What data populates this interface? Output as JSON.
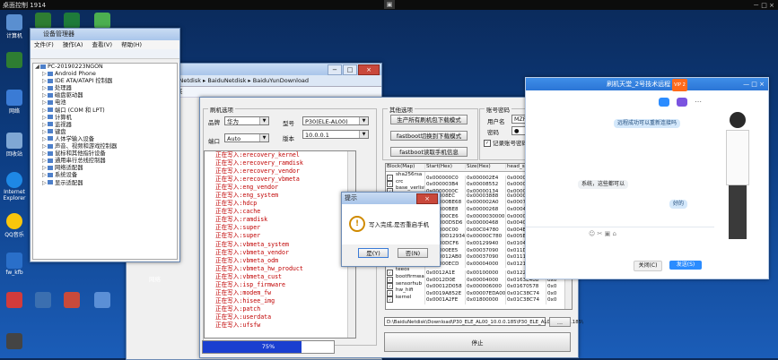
{
  "remote": {
    "title": "桌面控制 1914",
    "controls": "－ □ ×",
    "center_btn": "▣"
  },
  "desktop_icons": [
    {
      "label": "计算机",
      "color": "#5a8fd0"
    },
    {
      "label": "",
      "color": "#2e7d32"
    },
    {
      "label": "网络",
      "color": "#3a7bd5"
    },
    {
      "label": "回收站",
      "color": "#7fa7d4"
    },
    {
      "label": "Internet Explorer",
      "color": "#1e88e5"
    },
    {
      "label": "QQ音乐",
      "color": "#f9c60c"
    },
    {
      "label": "fw_kfb",
      "color": "#2a6fc9"
    },
    {
      "label": "",
      "color": "#d23b3b"
    }
  ],
  "devmgr": {
    "title": "设备管理器",
    "menu": [
      "文件(F)",
      "操作(A)",
      "查看(V)",
      "帮助(H)"
    ],
    "tree": [
      {
        "label": "PC-20190223NGON",
        "level": 0,
        "tri": "◢"
      },
      {
        "label": "Android Phone",
        "level": 1,
        "tri": "▷"
      },
      {
        "label": "IDE ATA/ATAPI 控制器",
        "level": 1,
        "tri": "▷"
      },
      {
        "label": "处理器",
        "level": 1,
        "tri": "▷"
      },
      {
        "label": "磁盘驱动器",
        "level": 1,
        "tri": "▷"
      },
      {
        "label": "电池",
        "level": 1,
        "tri": "▷"
      },
      {
        "label": "端口 (COM 和 LPT)",
        "level": 1,
        "tri": "▷"
      },
      {
        "label": "计算机",
        "level": 1,
        "tri": "▷"
      },
      {
        "label": "监视器",
        "level": 1,
        "tri": "▷"
      },
      {
        "label": "键盘",
        "level": 1,
        "tri": "▷"
      },
      {
        "label": "人体学输入设备",
        "level": 1,
        "tri": "▷"
      },
      {
        "label": "声音、视频和游戏控制器",
        "level": 1,
        "tri": "▷"
      },
      {
        "label": "鼠标和其他指针设备",
        "level": 1,
        "tri": "▷"
      },
      {
        "label": "通用串行总线控制器",
        "level": 1,
        "tri": "▷"
      },
      {
        "label": "网络适配器",
        "level": 1,
        "tri": "▷"
      },
      {
        "label": "系统设备",
        "level": 1,
        "tri": "▷"
      },
      {
        "label": "显示适配器",
        "level": 1,
        "tri": "▷"
      }
    ]
  },
  "explorer": {
    "address": "BaiduNetdisk ▸ BaiduNetdisk ▸ BaiduYunDownload",
    "new_folder": "新建文件夹",
    "network": "网络"
  },
  "flash": {
    "group_select": "刷机选项",
    "brand_label": "品牌",
    "brand_value": "华为",
    "model_label": "型号",
    "model_value": "P30(ELE-AL00)",
    "port_label": "端口",
    "port_value": "Auto",
    "version_label": "版本",
    "version_value": "10.0.0.1",
    "log": [
      "正在写入:erecovery_kernel",
      "正在写入:erecovery_ramdisk",
      "正在写入:erecovery_vendor",
      "正在写入:erecovery_vbmeta",
      "正在写入:eng_vendor",
      "正在写入:eng_system",
      "正在写入:hdcp",
      "正在写入:cache",
      "正在写入:ramdisk",
      "正在写入:super",
      "正在写入:super",
      "正在写入:vbmeta_system",
      "正在写入:vbmeta_vendor",
      "正在写入:vbmeta_odm",
      "正在写入:vbmeta_hw_product",
      "正在写入:vbmeta_cust",
      "正在写入:isp_firmware",
      "正在写入:modem_fw",
      "正在写入:hisee_img",
      "正在写入:patch",
      "正在写入:userdata",
      "正在写入:ufsfw"
    ],
    "progress": {
      "value": 0.75,
      "text": "75%"
    },
    "group_other": "其他选项",
    "btn_gen_rom": "生产所有刷机包下载模式",
    "btn_fastboot": "fastboot切换到下载模式",
    "btn_read_info": "fastboot读取手机信息",
    "group_account": "账号密码",
    "user_label": "用户名",
    "user_value": "MZF8089716",
    "pass_label": "密码",
    "pass_value": "●",
    "remember_label": "记录账号密码",
    "table_headers": [
      "Block(Map)",
      "Start(Hex)",
      "Size(Hex)",
      "head_sec",
      "head_sz"
    ],
    "table_rows": [
      {
        "name": "sha256rsa",
        "start": "0x000000C0",
        "size": "0x000002E4",
        "head": "0x00000050C",
        "tail": "0x0"
      },
      {
        "name": "crc",
        "start": "0x000003B4",
        "size": "0x00008552",
        "head": "0x00000A0C4",
        "tail": "0x0"
      },
      {
        "name": "base_verlist",
        "start": "0x0000000C",
        "size": "0x00000134",
        "head": "0x00004B3F0",
        "tail": "0x0"
      },
      {
        "name": "",
        "start": "0x00008EC",
        "size": "0x00003888",
        "head": "0x00004B4A0",
        "tail": "0x0"
      },
      {
        "name": "",
        "start": "0x00000BE68",
        "size": "0x000002A0",
        "head": "0x0007E1AC4",
        "tail": "0x0"
      },
      {
        "name": "",
        "start": "0x00000BE8",
        "size": "0x00000268",
        "head": "0x0004E1868",
        "tail": "0x0"
      },
      {
        "name": "",
        "start": "0x00000CE6",
        "size": "0x0000030000",
        "head": "0x00007CD54",
        "tail": "0x0"
      },
      {
        "name": "",
        "start": "0x00000D5D6",
        "size": "0x00000468",
        "head": "0x0040C1C8",
        "tail": "0x0"
      },
      {
        "name": "",
        "start": "0x00000C00",
        "size": "0x00C04780",
        "head": "0x004E2A20",
        "tail": "0x0"
      },
      {
        "name": "",
        "start": "0x0000D12934",
        "size": "0x00000C780",
        "head": "0x005EA3A0",
        "tail": "0x0"
      },
      {
        "name": "",
        "start": "0x0000DCF6",
        "size": "0x00129940",
        "head": "0x0104DA4A0",
        "tail": "0x0"
      },
      {
        "name": "",
        "start": "0x00000EE5",
        "size": "0x00037090",
        "head": "0x011D7636",
        "tail": "0x0"
      },
      {
        "name": "",
        "start": "0x000012AB0",
        "size": "0x00037090",
        "head": "0x0111CDC8",
        "tail": "0x0"
      },
      {
        "name": "",
        "start": "0x00000ECD",
        "size": "0x00004000",
        "head": "0x0121F058",
        "tail": "0x0"
      },
      {
        "name": "teeos",
        "start": "0x0012A1E",
        "size": "0x00100000",
        "head": "0x01223830",
        "tail": "0x0"
      },
      {
        "name": "bootfirmware",
        "start": "0x0012D0E",
        "size": "0x00004000",
        "head": "0x0163E408",
        "tail": "0x0"
      },
      {
        "name": "sensorhub",
        "start": "0x00012D058",
        "size": "0x000006000",
        "head": "0x01670578",
        "tail": "0x0"
      },
      {
        "name": "hw_hifi",
        "start": "0x0019A852E",
        "size": "0x00007EDA00",
        "head": "0x01C38C74",
        "tail": "0x0"
      },
      {
        "name": "kernel",
        "start": "0x0001A2FE",
        "size": "0x01800000",
        "head": "0x01C38C74",
        "tail": "0x0"
      }
    ],
    "path_value": "D:\\BaiduNetdisk\\Download\\P30_ELE_AL00_10.0.0.185\\P30_ELE_AL00_10.0.0.185\\",
    "browse_label": "...",
    "stop_label": "停止"
  },
  "dialog": {
    "title": "提示",
    "message": "写入完成,是否重启手机",
    "yes": "是(Y)",
    "no": "否(N)"
  },
  "chat": {
    "title": "刷机天堂_2号技术远程",
    "badge": "VIP 2",
    "msg_right1": "远程成功可以重新连接吗",
    "msg_left1": "系统，这些都可以",
    "msg_right2": "好的",
    "close_btn": "关闭(C)",
    "send_btn": "发送(S)"
  }
}
